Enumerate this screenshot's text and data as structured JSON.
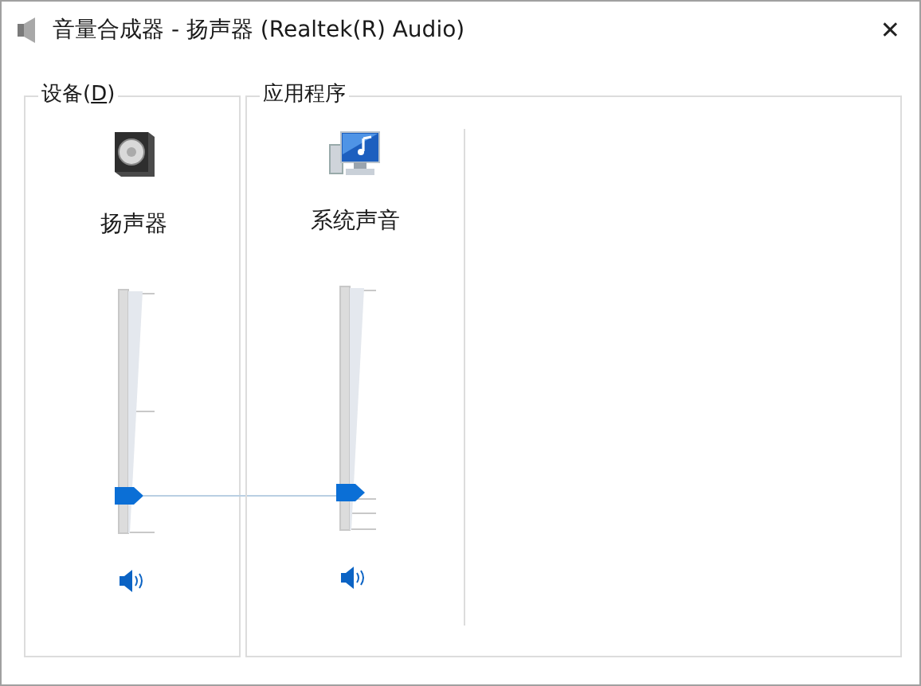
{
  "window": {
    "title": "音量合成器 - 扬声器 (Realtek(R) Audio)",
    "close": "✕"
  },
  "device_group": {
    "label": "设备(",
    "access_key": "D",
    "label_end": ")",
    "device": {
      "name": "扬声器",
      "level": 0.13,
      "muted": false
    }
  },
  "apps_group": {
    "label": "应用程序",
    "apps": [
      {
        "name": "系统声音",
        "level": 0.13,
        "muted": false
      }
    ]
  }
}
